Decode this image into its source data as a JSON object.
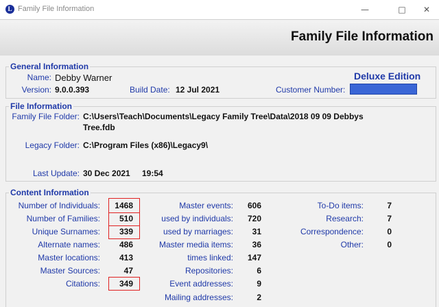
{
  "window": {
    "title": "Family File Information",
    "app_icon": "L"
  },
  "header": {
    "title": "Family File Information"
  },
  "general": {
    "legend": "General Information",
    "name_label": "Name:",
    "name_value": "Debby Warner",
    "version_label": "Version:",
    "version_value": "9.0.0.393",
    "build_label": "Build Date:",
    "build_value": "12 Jul 2021",
    "customer_label": "Customer Number:",
    "edition": "Deluxe Edition"
  },
  "file": {
    "legend": "File Information",
    "folder_label": "Family File Folder:",
    "folder_line1": "C:\\Users\\Teach\\Documents\\Legacy Family Tree\\Data\\2018 09 09 Debbys",
    "folder_line2": "Tree.fdb",
    "legacy_label": "Legacy Folder:",
    "legacy_value": "C:\\Program Files (x86)\\Legacy9\\",
    "update_label": "Last Update:",
    "update_date": "30 Dec 2021",
    "update_time": "19:54"
  },
  "content": {
    "legend": "Content Information",
    "col1": [
      {
        "label": "Number of Individuals:",
        "value": "1468"
      },
      {
        "label": "Number of Families:",
        "value": "510"
      },
      {
        "label": "Unique Surnames:",
        "value": "339"
      },
      {
        "label": "Alternate names:",
        "value": "486"
      },
      {
        "label": "Master locations:",
        "value": "413"
      },
      {
        "label": "Master Sources:",
        "value": "47"
      },
      {
        "label": "Citations:",
        "value": "349"
      }
    ],
    "col2": [
      {
        "label": "Master events:",
        "value": "606"
      },
      {
        "label": "used by individuals:",
        "value": "720"
      },
      {
        "label": "used by marriages:",
        "value": "31"
      },
      {
        "label": "Master media items:",
        "value": "36"
      },
      {
        "label": "times linked:",
        "value": "147"
      },
      {
        "label": "Repositories:",
        "value": "6"
      },
      {
        "label": "Event addresses:",
        "value": "9"
      },
      {
        "label": "Mailing addresses:",
        "value": "2"
      }
    ],
    "col3": [
      {
        "label": "To-Do items:",
        "value": "7"
      },
      {
        "label": "Research:",
        "value": "7"
      },
      {
        "label": "Correspondence:",
        "value": "0"
      },
      {
        "label": "Other:",
        "value": "0"
      }
    ]
  },
  "colors": {
    "label": "#1f39a8",
    "highlight_box": "#e02020",
    "redaction": "#3a66d6"
  }
}
